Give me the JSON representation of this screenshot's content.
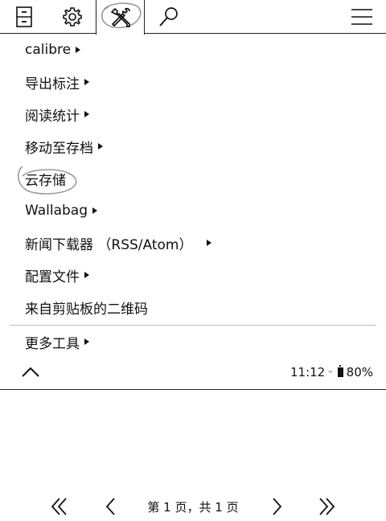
{
  "tabs": [
    {
      "name": "filing-cabinet",
      "icon": "filing-cabinet-icon",
      "active": false
    },
    {
      "name": "settings",
      "icon": "gear-icon",
      "active": false
    },
    {
      "name": "tools",
      "icon": "tools-icon",
      "active": true
    },
    {
      "name": "search",
      "icon": "search-icon",
      "active": false
    },
    {
      "name": "menu",
      "icon": "hamburger-icon",
      "active": false
    }
  ],
  "menu": {
    "items": [
      {
        "label": "calibre",
        "submenu": true
      },
      {
        "label": "导出标注",
        "submenu": true
      },
      {
        "label": "阅读统计",
        "submenu": true
      },
      {
        "label": "移动至存档",
        "submenu": true
      },
      {
        "label": "云存储",
        "submenu": false
      },
      {
        "label": "Wallabag",
        "submenu": true
      },
      {
        "label": "新闻下载器 （RSS/Atom）",
        "submenu": true
      },
      {
        "label": "配置文件",
        "submenu": true
      },
      {
        "label": "来自剪贴板的二维码",
        "submenu": false
      },
      {
        "label": "更多工具",
        "submenu": true
      }
    ]
  },
  "status": {
    "time": "11:12",
    "battery": "80%"
  },
  "pager": {
    "label": "第 1 页，共 1 页"
  }
}
